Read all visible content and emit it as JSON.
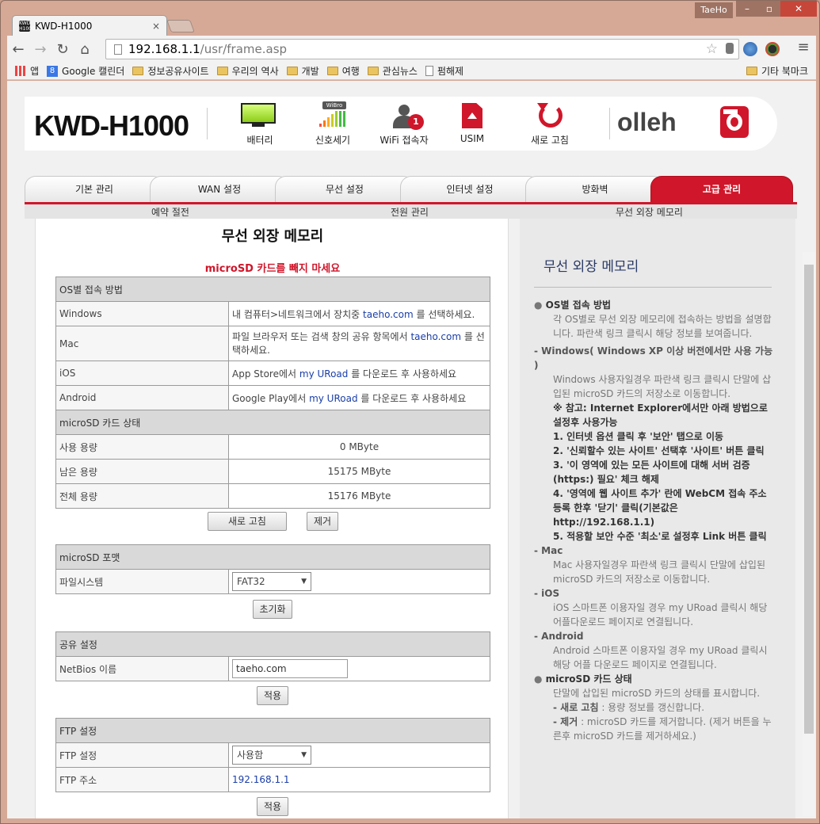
{
  "browser": {
    "tab_title": "KWD-H1000",
    "tab_favicon": "KWD H1000",
    "tab_close": "×",
    "user": "TaeHo",
    "window_controls": [
      "–",
      "▫",
      "✕"
    ],
    "url_host": "192.168.1.1",
    "url_path": "/usr/frame.asp",
    "nav_back": "←",
    "nav_forward": "→",
    "nav_reload": "↻",
    "nav_home": "⌂",
    "star": "☆",
    "menu": "≡",
    "bookmarks": [
      {
        "label": "앱",
        "icon": "apps-icon"
      },
      {
        "label": "Google 캘린더",
        "icon": "google-icon"
      },
      {
        "label": "정보공유사이트",
        "icon": "folder-icon"
      },
      {
        "label": "우리의 역사",
        "icon": "folder-icon"
      },
      {
        "label": "개발",
        "icon": "folder-icon"
      },
      {
        "label": "여행",
        "icon": "folder-icon"
      },
      {
        "label": "관심뉴스",
        "icon": "folder-icon"
      },
      {
        "label": "펌해제",
        "icon": "page-icon"
      }
    ],
    "other_bookmarks": "기타 북마크"
  },
  "header": {
    "model": "KWD-H1000",
    "items": [
      {
        "label": "배터리",
        "icon": "battery-icon"
      },
      {
        "label": "신호세기",
        "icon": "signal-icon",
        "badge": "WiBro"
      },
      {
        "label": "WiFi 접속자",
        "icon": "user-icon",
        "count": "1"
      },
      {
        "label": "USIM",
        "icon": "usim-icon"
      },
      {
        "label": "새로 고침",
        "icon": "refresh-icon"
      }
    ],
    "brand": "olleh",
    "accent": "#d0162a"
  },
  "tabs": [
    "기본 관리",
    "WAN 설정",
    "무선 설정",
    "인터넷 설정",
    "방화벽",
    "고급 관리"
  ],
  "active_tab": 5,
  "subnav": [
    "예약 절전",
    "전원 관리",
    "무선 외장 메모리"
  ],
  "content": {
    "title": "무선 외장 메모리",
    "warning": "microSD 카드를 빼지 마세요",
    "os_section": {
      "heading": "OS별 접속 방법",
      "rows": [
        {
          "os": "Windows",
          "pre": "내 컴퓨터>네트워크에서 장치중 ",
          "link": "taeho.com",
          "post": " 를 선택하세요."
        },
        {
          "os": "Mac",
          "pre": "파일 브라우저 또는 검색 창의 공유 항목에서 ",
          "link": "taeho.com",
          "post": " 를 선택하세요."
        },
        {
          "os": "iOS",
          "pre": "App Store에서 ",
          "link": "my URoad",
          "post": " 를 다운로드 후 사용하세요"
        },
        {
          "os": "Android",
          "pre": "Google Play에서 ",
          "link": "my URoad",
          "post": " 를 다운로드 후 사용하세요"
        }
      ]
    },
    "status_section": {
      "heading": "microSD 카드 상태",
      "rows": [
        {
          "label": "사용 용량",
          "value": "0 MByte"
        },
        {
          "label": "남은 용량",
          "value": "15175 MByte"
        },
        {
          "label": "전체 용량",
          "value": "15176 MByte"
        }
      ],
      "refresh_button": "새로 고침",
      "remove_button": "제거"
    },
    "format_section": {
      "heading": "microSD 포맷",
      "label": "파일시스템",
      "value": "FAT32",
      "button": "초기화"
    },
    "share_section": {
      "heading": "공유 설정",
      "label": "NetBios 이름",
      "value": "taeho.com",
      "button": "적용"
    },
    "ftp_section": {
      "heading": "FTP 설정",
      "ftp_label": "FTP 설정",
      "ftp_value": "사용함",
      "addr_label": "FTP 주소",
      "addr_value": "192.168.1.1",
      "button": "적용"
    }
  },
  "help": {
    "title": "무선 외장 메모리",
    "os_heading": "OS별 접속 방법",
    "os_text": "각 OS별로 무선 외장 메모리에 접속하는 방법을 설명합니다. 파란색 링크 클릭시 해당 정보를 보여줍니다.",
    "win_heading": "- Windows( Windows XP 이상 버전에서만 사용 가능 )",
    "win_text": "Windows 사용자일경우 파란색 링크 클릭시 단말에 삽입된 microSD 카드의 저장소로 이동합니다.",
    "note": "※ 참고: Internet Explorer에서만 아래 방법으로 설정후 사용가능",
    "steps": [
      "1. 인터넷 옵션 클릭 후 '보안' 탭으로 이동",
      "2. '신뢰할수 있는 사이트' 선택후 '사이트' 버튼 클릭",
      "3. '이 영역에 있는 모든 사이트에 대해 서버 검증(https:) 필요' 체크 해제",
      "4. '영역에 웹 사이트 추가' 란에 WebCM 접속 주소 등록 한후 '닫기' 클릭(기본값은 http://192.168.1.1)",
      "5. 적용할 보안 수준 '최소'로 설정후 Link 버튼 클릭"
    ],
    "mac_heading": "- Mac",
    "mac_text": "Mac 사용자일경우 파란색 링크 클릭시 단말에 삽입된 microSD 카드의 저장소로 이동합니다.",
    "ios_heading": "- iOS",
    "ios_text": "iOS 스마트폰 이용자일 경우 my URoad 클릭시 해당 어플다운로드 페이지로 연결됩니다.",
    "and_heading": "- Android",
    "and_text": "Android 스마트폰 이용자일 경우 my URoad 클릭시 해당 어플 다운로드 페이지로 연결됩니다.",
    "sd_heading": "microSD 카드 상태",
    "sd_text": "단말에 삽입된 microSD 카드의 상태를 표시합니다.",
    "sd_refresh_b": "- 새로 고침",
    "sd_refresh_t": " : 용량 정보를 갱신합니다.",
    "sd_remove_b": "- 제거",
    "sd_remove_t": " : microSD 카드를 제거합니다. (제거 버튼을 누른후 microSD 카드를 제거하세요.)"
  }
}
